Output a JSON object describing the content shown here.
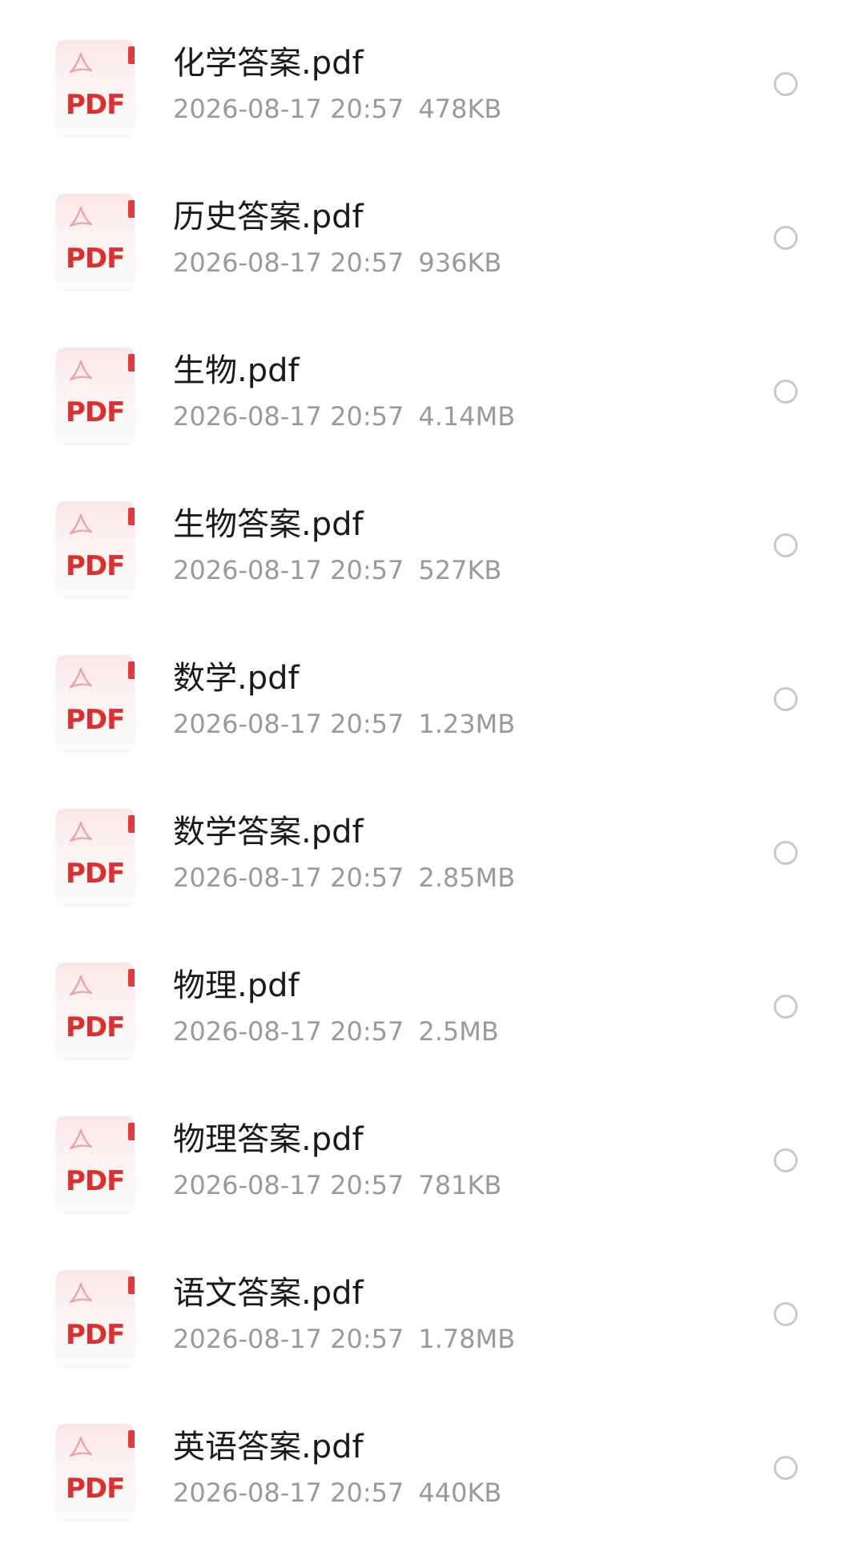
{
  "icon": {
    "type_label": "PDF",
    "name": "pdf-file-icon",
    "accent_color": "#e02d2d"
  },
  "files": [
    {
      "name": "化学答案.pdf",
      "date": "2026-08-17 20:57",
      "size": "478KB"
    },
    {
      "name": "历史答案.pdf",
      "date": "2026-08-17 20:57",
      "size": "936KB"
    },
    {
      "name": "生物.pdf",
      "date": "2026-08-17 20:57",
      "size": "4.14MB"
    },
    {
      "name": "生物答案.pdf",
      "date": "2026-08-17 20:57",
      "size": "527KB"
    },
    {
      "name": "数学.pdf",
      "date": "2026-08-17 20:57",
      "size": "1.23MB"
    },
    {
      "name": "数学答案.pdf",
      "date": "2026-08-17 20:57",
      "size": "2.85MB"
    },
    {
      "name": "物理.pdf",
      "date": "2026-08-17 20:57",
      "size": "2.5MB"
    },
    {
      "name": "物理答案.pdf",
      "date": "2026-08-17 20:57",
      "size": "781KB"
    },
    {
      "name": "语文答案.pdf",
      "date": "2026-08-17 20:57",
      "size": "1.78MB"
    },
    {
      "name": "英语答案.pdf",
      "date": "2026-08-17 20:57",
      "size": "440KB"
    }
  ]
}
